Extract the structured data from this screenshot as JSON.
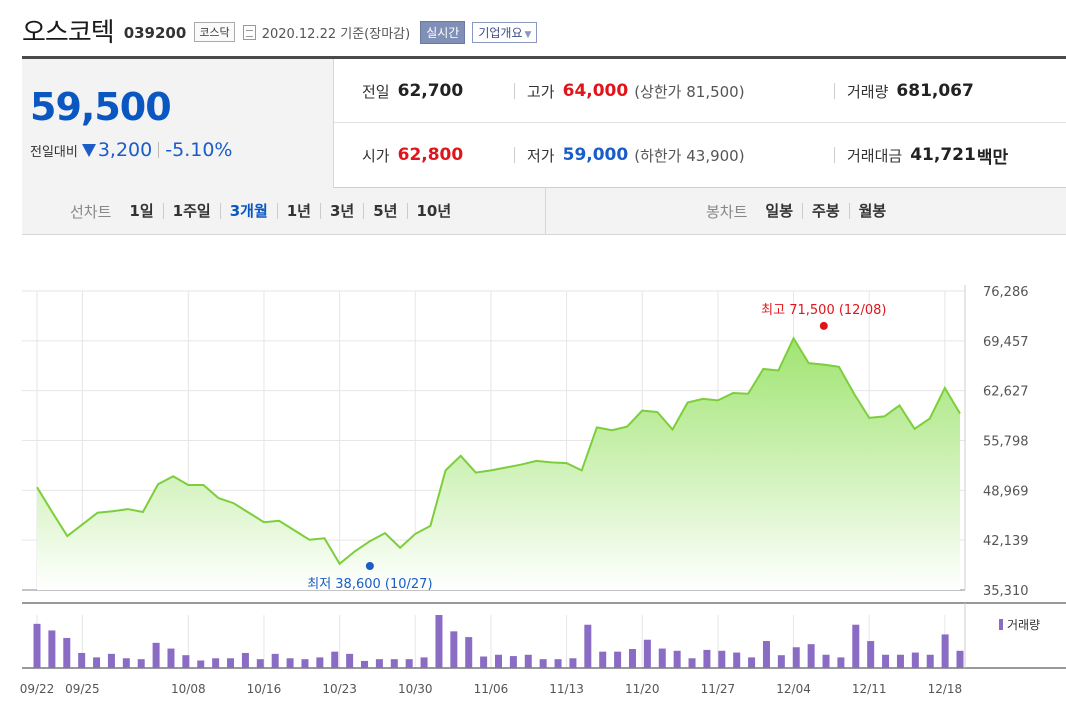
{
  "header": {
    "company": "오스코텍",
    "code": "039200",
    "market": "코스닥",
    "date": "2020.12.22 기준(장마감)",
    "realtime_btn": "실시간",
    "overview_btn": "기업개요",
    "overview_caret": "▼"
  },
  "summary": {
    "price": "59,500",
    "change_label": "전일대비",
    "change_amount": "3,200",
    "change_percent": "-5.10%",
    "direction_color": "#1a5cc8",
    "stats": {
      "prev_close": {
        "label": "전일",
        "value": "62,700"
      },
      "high": {
        "label": "고가",
        "value": "64,000",
        "sub": "(상한가 81,500)"
      },
      "volume": {
        "label": "거래량",
        "value": "681,067"
      },
      "open": {
        "label": "시가",
        "value": "62,800"
      },
      "low": {
        "label": "저가",
        "value": "59,000",
        "sub": "(하한가 43,900)"
      },
      "amount": {
        "label": "거래대금",
        "value": "41,721",
        "unit": "백만"
      }
    }
  },
  "tabs": {
    "line_chart_label": "선차트",
    "line_periods": [
      "1일",
      "1주일",
      "3개월",
      "1년",
      "3년",
      "5년",
      "10년"
    ],
    "active_period": "3개월",
    "candle_chart_label": "봉차트",
    "candle_periods": [
      "일봉",
      "주봉",
      "월봉"
    ]
  },
  "chart_data": {
    "type": "area",
    "ylim": [
      35310,
      76286
    ],
    "yticks": [
      "76,286",
      "69,457",
      "62,627",
      "55,798",
      "48,969",
      "42,139",
      "35,310"
    ],
    "x_tick_labels": [
      "09/22",
      "09/25",
      "10/08",
      "10/16",
      "10/23",
      "10/30",
      "11/06",
      "11/13",
      "11/20",
      "11/27",
      "12/04",
      "12/11",
      "12/18"
    ],
    "x_tick_indices": [
      0,
      3,
      10,
      15,
      20,
      25,
      30,
      35,
      40,
      45,
      50,
      55,
      60
    ],
    "series": [
      {
        "values": [
          49400,
          46000,
          42700,
          44300,
          45900,
          46100,
          46400,
          46000,
          49800,
          50900,
          49700,
          49700,
          47900,
          47200,
          45900,
          44600,
          44800,
          43500,
          42200,
          42400,
          38900,
          40600,
          42000,
          43100,
          41100,
          43000,
          44100,
          51700,
          53700,
          51400,
          51700,
          52100,
          52500,
          53000,
          52800,
          52700,
          51700,
          57600,
          57200,
          57700,
          59900,
          59700,
          57300,
          61000,
          61500,
          61300,
          62300,
          62200,
          65600,
          65400,
          69800,
          66400,
          66200,
          65900,
          62200,
          58900,
          59100,
          60600,
          57400,
          58800,
          63000,
          59500
        ]
      }
    ],
    "volume": [
      1.0,
      0.85,
      0.68,
      0.34,
      0.24,
      0.32,
      0.22,
      0.2,
      0.57,
      0.44,
      0.29,
      0.17,
      0.22,
      0.22,
      0.34,
      0.2,
      0.32,
      0.22,
      0.2,
      0.24,
      0.37,
      0.32,
      0.16,
      0.2,
      0.2,
      0.2,
      0.24,
      1.2,
      0.83,
      0.7,
      0.26,
      0.3,
      0.27,
      0.3,
      0.2,
      0.2,
      0.22,
      0.98,
      0.37,
      0.37,
      0.43,
      0.64,
      0.44,
      0.39,
      0.22,
      0.41,
      0.39,
      0.35,
      0.24,
      0.61,
      0.29,
      0.47,
      0.54,
      0.3,
      0.24,
      0.98,
      0.61,
      0.3,
      0.3,
      0.35,
      0.3,
      0.76,
      0.39
    ],
    "annotations": {
      "max": {
        "label": "최고 71,500 (12/08)",
        "index": 52,
        "value": 71500
      },
      "min": {
        "label": "최저 38,600 (10/27)",
        "index": 22,
        "value": 38600
      }
    },
    "volume_legend": "거래량",
    "colors": {
      "line": "#7cce3a",
      "fill_top": "#9be36a",
      "fill_bottom": "#ffffff",
      "volume": "#8a6cc4",
      "max_marker": "#e0151b",
      "min_marker": "#1a5cc8",
      "grid": "#e6e6e6"
    }
  }
}
